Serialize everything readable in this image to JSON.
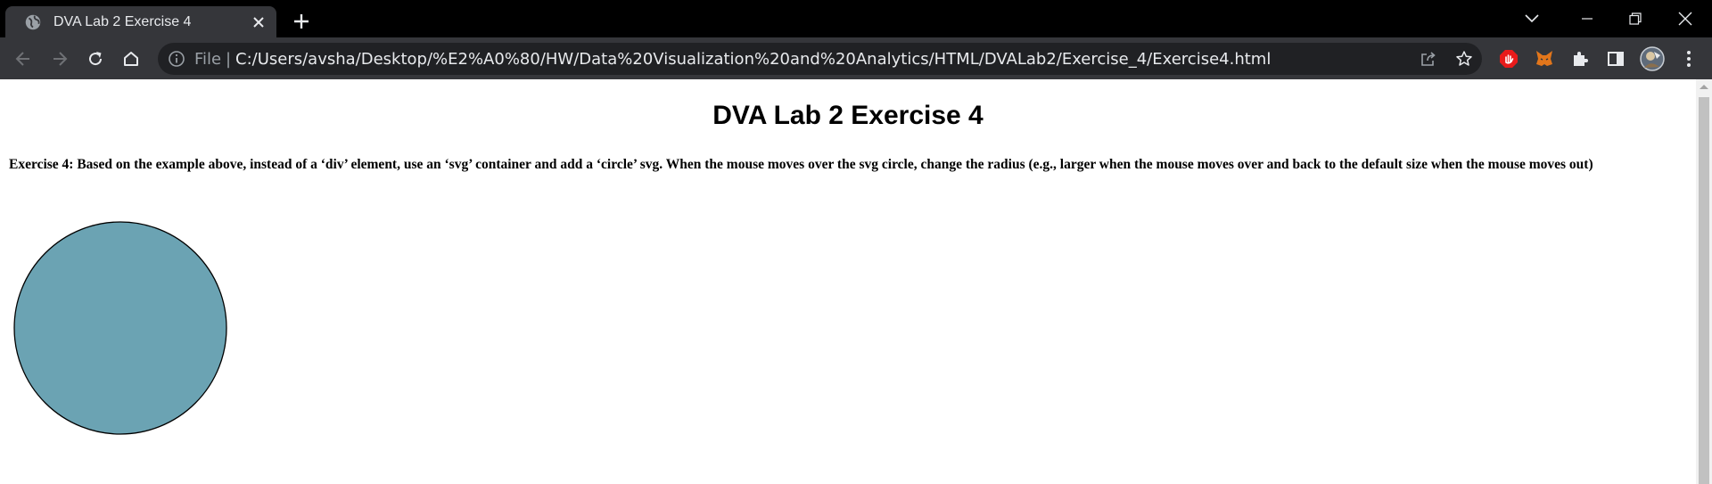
{
  "browser": {
    "tab": {
      "title": "DVA Lab 2 Exercise 4"
    },
    "address_bar": {
      "scheme_label": "File",
      "separator": "|",
      "url": "C:/Users/avsha/Desktop/%E2%A0%80/HW/Data%20Visualization%20and%20Analytics/HTML/DVALab2/Exercise_4/Exercise4.html"
    },
    "icons": {
      "favicon": "globe-icon",
      "close_tab": "close-icon",
      "new_tab": "plus-icon",
      "back": "back-arrow-icon",
      "forward": "forward-arrow-icon",
      "reload": "reload-icon",
      "home": "home-icon",
      "info": "info-icon",
      "share": "share-icon",
      "bookmark": "star-icon",
      "extension_1": "adblock-icon",
      "extension_2": "metamask-fox-icon",
      "extensions": "puzzle-icon",
      "side_panel": "side-panel-icon",
      "profile": "avatar",
      "menu": "kebab-menu-icon"
    },
    "colors": {
      "tabbar_bg": "#000000",
      "toolbar_bg": "#35363a",
      "omnibox_bg": "#202124",
      "text": "#e8eaed"
    }
  },
  "page": {
    "heading": "DVA Lab 2 Exercise 4",
    "exercise_text": "Exercise 4: Based on the example above, instead of a ‘div’ element, use an ‘svg’ container and add a ‘circle’ svg. When the mouse moves over the svg circle, change the radius (e.g., larger when the mouse moves over and back to the default size when the mouse moves out)",
    "circle": {
      "fill": "#6ba3b3",
      "stroke": "#000000"
    }
  }
}
